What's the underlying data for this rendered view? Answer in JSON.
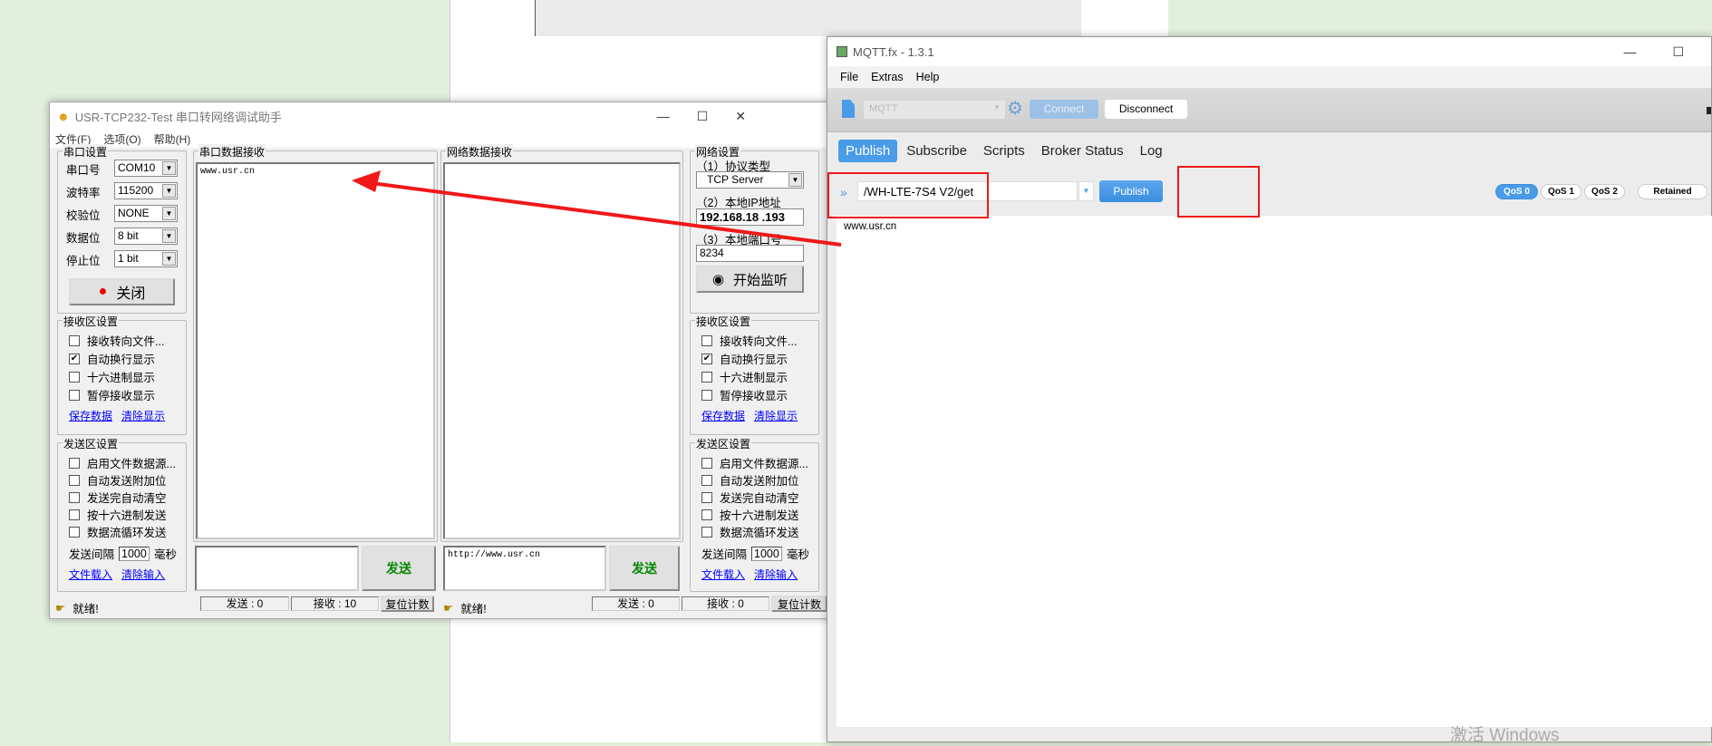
{
  "usr": {
    "title": "USR-TCP232-Test 串口转网络调试助手",
    "menu": [
      "文件(F)",
      "选项(O)",
      "帮助(H)"
    ],
    "serial": {
      "legend": "串口设置",
      "fields": [
        {
          "label": "串口号",
          "value": "COM10"
        },
        {
          "label": "波特率",
          "value": "115200"
        },
        {
          "label": "校验位",
          "value": "NONE"
        },
        {
          "label": "数据位",
          "value": "8 bit"
        },
        {
          "label": "停止位",
          "value": "1 bit"
        }
      ],
      "close_button": "关闭"
    },
    "recv_settings": {
      "legend": "接收区设置",
      "options": [
        {
          "label": "接收转向文件...",
          "checked": false
        },
        {
          "label": "自动换行显示",
          "checked": true
        },
        {
          "label": "十六进制显示",
          "checked": false
        },
        {
          "label": "暂停接收显示",
          "checked": false
        }
      ],
      "save": "保存数据",
      "clear": "清除显示"
    },
    "send_settings": {
      "legend": "发送区设置",
      "options": [
        "启用文件数据源...",
        "自动发送附加位",
        "发送完自动清空",
        "按十六进制发送",
        "数据流循环发送"
      ],
      "interval_label": "发送间隔",
      "interval": "1000",
      "unit": "毫秒",
      "load": "文件载入",
      "clear": "清除输入"
    },
    "serial_recv": {
      "legend": "串口数据接收",
      "content": "www.usr.cn",
      "send_input": "",
      "send_button": "发送"
    },
    "net_recv": {
      "legend": "网络数据接收",
      "content": "",
      "send_input": "http://www.usr.cn",
      "send_button": "发送"
    },
    "net": {
      "legend": "网络设置",
      "protocol_label": "（1）协议类型",
      "protocol": "TCP Server",
      "ip_label": "（2）本地IP地址",
      "ip": "192.168.18 .193",
      "port_label": "（3）本地端口号",
      "port": "8234",
      "listen_button": "开始监听"
    },
    "status": {
      "ready": "就绪!",
      "left_sent": "发送 : 0",
      "left_recv": "接收 : 10",
      "reset": "复位计数",
      "right_sent": "发送 : 0",
      "right_recv": "接收 : 0"
    },
    "ok_check": "✔"
  },
  "mqtt": {
    "title": "MQTT.fx - 1.3.1",
    "menu": [
      "File",
      "Extras",
      "Help"
    ],
    "profile": "MQTT",
    "connect": "Connect",
    "disconnect": "Disconnect",
    "tabs": [
      "Publish",
      "Subscribe",
      "Scripts",
      "Broker Status",
      "Log"
    ],
    "topic": "/WH-LTE-7S4 V2/get",
    "publish": "Publish",
    "qos": [
      "QoS 0",
      "QoS 1",
      "QoS 2"
    ],
    "retained": "Retained",
    "message": "www.usr.cn",
    "accent": "#4a9be8"
  },
  "watermark": "激活 Windows"
}
